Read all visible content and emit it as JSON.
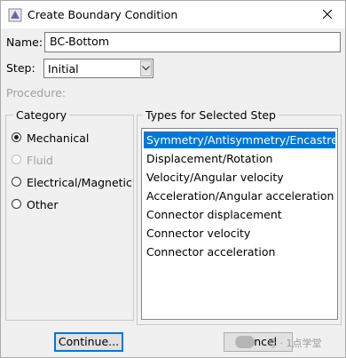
{
  "window": {
    "title": "Create Boundary Condition"
  },
  "form": {
    "name_label": "Name:",
    "name_value": "BC-Bottom",
    "step_label": "Step:",
    "step_value": "Initial",
    "procedure_label": "Procedure:"
  },
  "category": {
    "title": "Category",
    "options": [
      {
        "label": "Mechanical",
        "checked": true,
        "disabled": false
      },
      {
        "label": "Fluid",
        "checked": false,
        "disabled": true
      },
      {
        "label": "Electrical/Magnetic",
        "checked": false,
        "disabled": false
      },
      {
        "label": "Other",
        "checked": false,
        "disabled": false
      }
    ]
  },
  "types": {
    "title": "Types for Selected Step",
    "items": [
      "Symmetry/Antisymmetry/Encastre",
      "Displacement/Rotation",
      "Velocity/Angular velocity",
      "Acceleration/Angular acceleration",
      "Connector displacement",
      "Connector velocity",
      "Connector acceleration"
    ],
    "selected_index": 0
  },
  "buttons": {
    "continue_label": "Continue...",
    "cancel_label": "Cancel"
  },
  "watermark": {
    "text": "号 · 1点学堂"
  },
  "colors": {
    "selection": "#0078d7",
    "dialog_bg": "#f0f0f0",
    "disabled_text": "#a0a0a0"
  }
}
